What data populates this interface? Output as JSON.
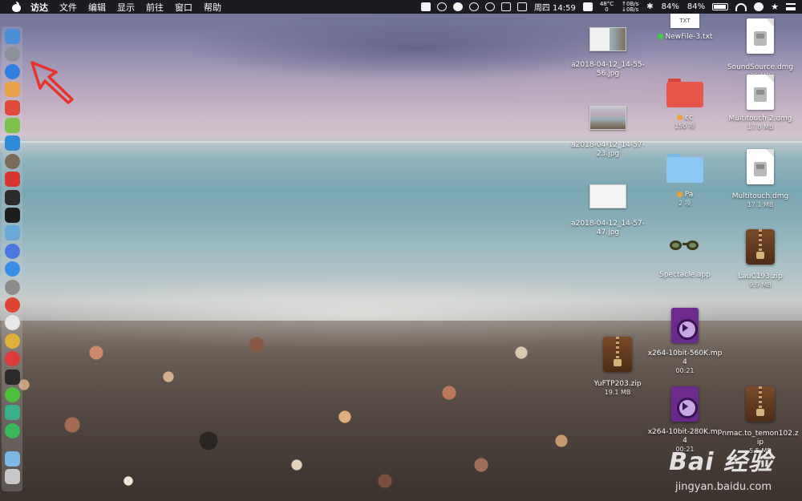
{
  "menubar": {
    "items": [
      "访达",
      "文件",
      "编辑",
      "显示",
      "前往",
      "窗口",
      "帮助"
    ],
    "status": {
      "temperature": "48°C",
      "temp_second": "0",
      "net_up": "↑0B/s",
      "net_down": "↓0B/s",
      "datetime": "周四 14:59",
      "battery_1": "84%",
      "battery_2": "84%"
    }
  },
  "desktop": {
    "items": [
      {
        "name": "NewFile-3.txt",
        "thumb_text": "TXT",
        "tag_color": "#3ecf4a"
      },
      {
        "name": "a2018-04-12_14-55-56.jpg"
      },
      {
        "name": "SoundSource.dmg",
        "size": "25 MB"
      },
      {
        "name": "cc",
        "size": "150 项",
        "tag_color": "#f0a030"
      },
      {
        "name": "a2018-04-12_14-57-23.jpg"
      },
      {
        "name": "Multitouch 2.dmg",
        "size": "17.8 MB"
      },
      {
        "name": "Pa",
        "size": "2 项",
        "tag_color": "#f0a030"
      },
      {
        "name": "a2018-04-12_14-57-47.jpg"
      },
      {
        "name": "Multitouch.dmg",
        "size": "17.1 MB"
      },
      {
        "name": "Spectacle.app"
      },
      {
        "name": "LauC193.zip",
        "size": "9.9 MB"
      },
      {
        "name": "x264-10bit-560K.mp4",
        "size": "00:21"
      },
      {
        "name": "YuFTP203.zip",
        "size": "19.1 MB"
      },
      {
        "name": "x264-10bit-280K.mp4",
        "size": "00:21"
      },
      {
        "name": "nmac.to_temon102.zip",
        "size": "5.5 MB"
      }
    ]
  },
  "dock": {
    "apps": [
      {
        "icon": "finder-icon",
        "color": "#4a90d9"
      },
      {
        "icon": "launchpad-icon",
        "color": "#8a8f99"
      },
      {
        "icon": "safari-icon",
        "color": "#2f7fe0"
      },
      {
        "icon": "contacts-icon",
        "color": "#e8a34a"
      },
      {
        "icon": "red-app-icon",
        "color": "#e04a3a"
      },
      {
        "icon": "android-icon",
        "color": "#7cc24a"
      },
      {
        "icon": "teamviewer-icon",
        "color": "#2f8ad8"
      },
      {
        "icon": "globe-app-icon",
        "color": "#7a6a58"
      },
      {
        "icon": "netease-music-icon",
        "color": "#d8362f"
      },
      {
        "icon": "activity-monitor-icon",
        "color": "#2b2b2b"
      },
      {
        "icon": "terminal-icon",
        "color": "#1e1e1e"
      },
      {
        "icon": "preview-icon",
        "color": "#6aa8d8"
      },
      {
        "icon": "siri-icon",
        "color": "#4a78e0"
      },
      {
        "icon": "app-store-icon",
        "color": "#3a8de8"
      },
      {
        "icon": "system-preferences-icon",
        "color": "#8c8c8c"
      },
      {
        "icon": "weibo-icon",
        "color": "#e2452f"
      },
      {
        "icon": "yandex-icon",
        "color": "#e8e8e8"
      },
      {
        "icon": "chrome-icon",
        "color": "#e0b13a"
      },
      {
        "icon": "vivaldi-icon",
        "color": "#e03a3a"
      },
      {
        "icon": "iterm-icon",
        "color": "#2a2a2a"
      },
      {
        "icon": "wechat-icon",
        "color": "#4cbf3a"
      },
      {
        "icon": "sync-app-icon",
        "color": "#3aaf8a"
      },
      {
        "icon": "refresh-app-icon",
        "color": "#3ab85a"
      },
      {
        "icon": "downloads-folder-icon",
        "color": "#7ab8e8"
      },
      {
        "icon": "trash-icon",
        "color": "#c8c8c8"
      }
    ]
  },
  "watermark": {
    "brand": "Bai 经验",
    "url": "jingyan.baidu.com"
  }
}
